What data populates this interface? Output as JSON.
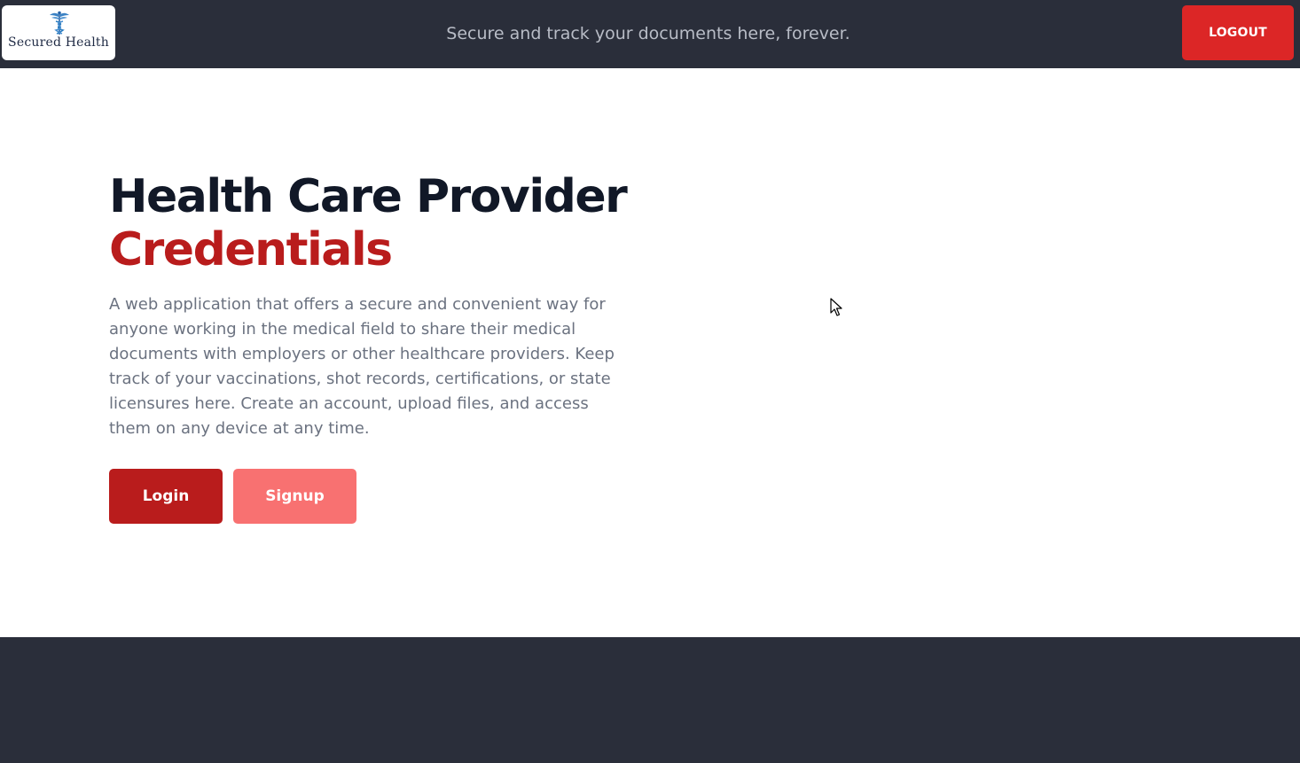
{
  "header": {
    "logo_text": "Secured Health",
    "logo_icon": "caduceus-icon",
    "tagline": "Secure and track your documents here, forever.",
    "logout_label": "LOGOUT"
  },
  "hero": {
    "title_line1": "Health Care Provider",
    "title_line2": "Credentials",
    "description": "A web application that offers a secure and convenient way for anyone working in the medical field to share their medical documents with employers or other healthcare providers. Keep track of your vaccinations, shot records, certifications, or state licensures here. Create an account, upload files, and access them on any device at any time.",
    "login_label": "Login",
    "signup_label": "Signup"
  },
  "colors": {
    "header_bg": "#2a2e3a",
    "accent_red": "#b91c1c",
    "logout_red": "#dc2626",
    "signup_pink": "#f87171",
    "title_dark": "#111827"
  }
}
